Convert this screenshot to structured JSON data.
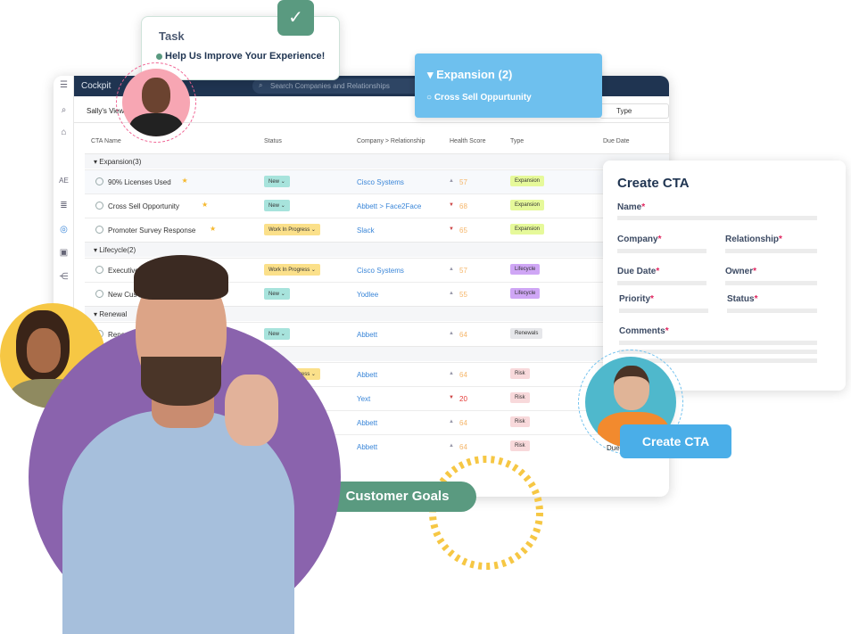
{
  "app": {
    "title": "Cockpit",
    "search_placeholder": "Search Companies and Relationships",
    "view": "Sally's View",
    "type_filter": "Type",
    "sidebar_ae": "AE"
  },
  "table": {
    "headers": [
      "CTA Name",
      "Status",
      "Company > Relationship",
      "Health Score",
      "Type",
      "Due Date"
    ],
    "groups": [
      {
        "label": "Expansion",
        "count": "(3)",
        "rows": [
          {
            "name": "90% Licenses Used",
            "star": true,
            "status": "New",
            "company": "Cisco Systems",
            "trend": "up",
            "score": "57",
            "type": "Expansion"
          },
          {
            "name": "Cross Sell Opportunity",
            "star": true,
            "status": "New",
            "company": "Abbett > Face2Face",
            "trend": "down",
            "score": "68",
            "type": "Expansion"
          },
          {
            "name": "Promoter Survey Response",
            "star": true,
            "status": "Work In Progress",
            "company": "Slack",
            "trend": "down",
            "score": "65",
            "type": "Expansion"
          }
        ]
      },
      {
        "label": "Lifecycle",
        "count": "(2)",
        "rows": [
          {
            "name": "Executive Bu",
            "status": "Work In Progress",
            "company": "Cisco Systems",
            "trend": "up",
            "score": "57",
            "type": "Lifecycle"
          },
          {
            "name": "New Cus",
            "status": "New",
            "company": "Yodlee",
            "trend": "up",
            "score": "55",
            "type": "Lifecycle"
          }
        ]
      },
      {
        "label": "Renewal",
        "count": "",
        "rows": [
          {
            "name": "Rene",
            "status": "New",
            "company": "Abbett",
            "trend": "up",
            "score": "64",
            "type": "Renewals"
          }
        ]
      },
      {
        "label": "",
        "count": "",
        "rows": [
          {
            "name": "",
            "status": "Work In Progress",
            "company": "Abbett",
            "trend": "up",
            "score": "64",
            "type": "Risk"
          },
          {
            "name": "",
            "status": "",
            "company": "Yext",
            "trend": "down",
            "score": "20",
            "type": "Risk"
          },
          {
            "name": "",
            "status": "",
            "company": "Abbett",
            "trend": "up",
            "score": "64",
            "type": "Risk"
          },
          {
            "name": "",
            "status": "",
            "company": "Abbett",
            "trend": "up",
            "score": "64",
            "type": "Risk",
            "due": "Due"
          }
        ]
      }
    ]
  },
  "task": {
    "title": "Task",
    "item": "Help Us Improve Your Experience!"
  },
  "expansion_popup": {
    "title": "Expansion (2)",
    "item": "Cross Sell Oppurtunity"
  },
  "create_cta": {
    "title": "Create CTA",
    "fields": [
      "Name",
      "Company",
      "Relationship",
      "Due Date",
      "Owner",
      "Priority",
      "Status",
      "Comments"
    ],
    "button": "Create CTA"
  },
  "goals": {
    "label": "Customer Goals"
  },
  "colors": {
    "navy": "#1f3451",
    "green": "#5a9a80",
    "blue": "#6ec0ee",
    "purple": "#8a63ad",
    "yellow": "#f6c744",
    "new": "#a7e3dc",
    "wip": "#fbe08a",
    "expansion": "#e6f99a",
    "lifecycle": "#cfa6f5",
    "renewals": "#e6e7ea",
    "risk": "#f8d9db"
  }
}
